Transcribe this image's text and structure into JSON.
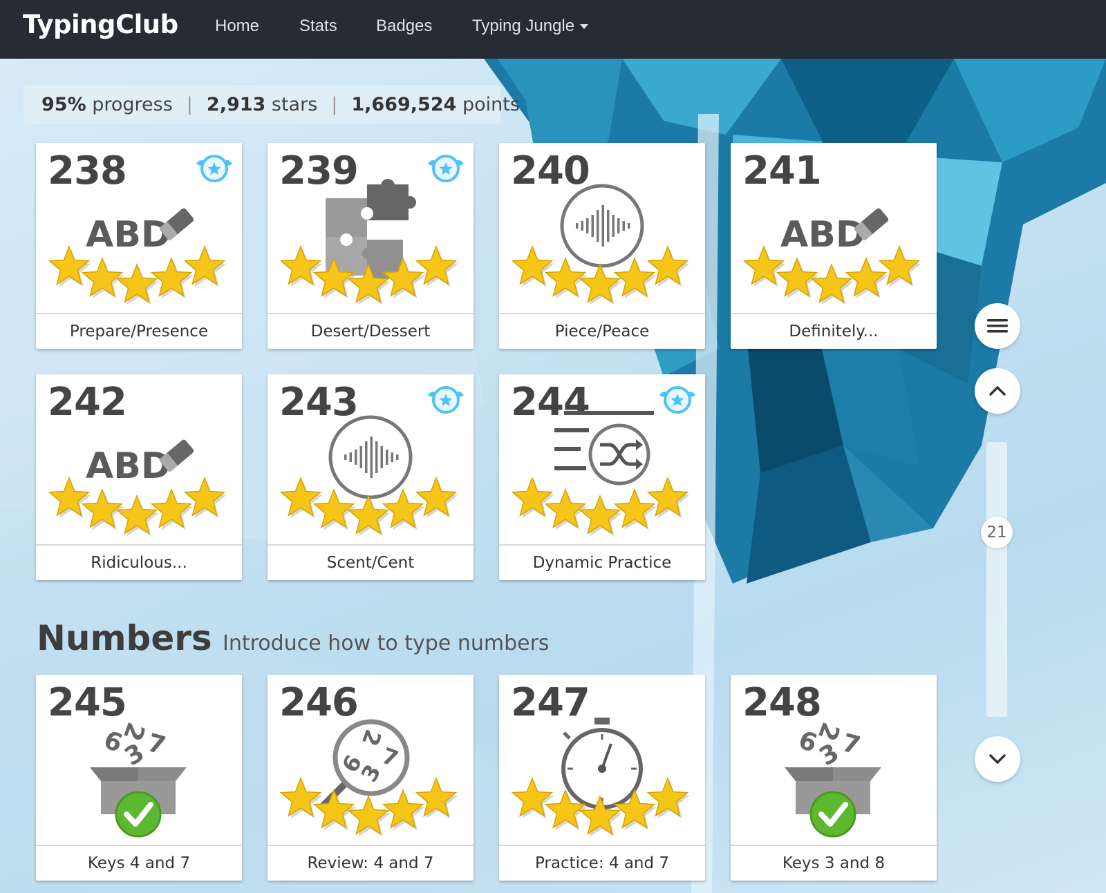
{
  "app": {
    "brand": "TypingClub"
  },
  "nav": {
    "home": "Home",
    "stats": "Stats",
    "badges": "Badges",
    "course": "Typing Jungle"
  },
  "stats": {
    "progress_value": "95%",
    "progress_label": "progress",
    "stars_value": "2,913",
    "stars_label": "stars",
    "points_value": "1,669,524",
    "points_label": "points"
  },
  "lessons": [
    {
      "number": "238",
      "title": "Prepare/Presence",
      "icon": "eraser-abc-icon",
      "stars": 5,
      "badge": true
    },
    {
      "number": "239",
      "title": "Desert/Dessert",
      "icon": "puzzle-icon",
      "stars": 5,
      "badge": true
    },
    {
      "number": "240",
      "title": "Piece/Peace",
      "icon": "sound-wave-icon",
      "stars": 5,
      "badge": false
    },
    {
      "number": "241",
      "title": "Definitely...",
      "icon": "eraser-abc-icon",
      "stars": 5,
      "badge": false
    },
    {
      "number": "242",
      "title": "Ridiculous...",
      "icon": "eraser-abc-icon",
      "stars": 5,
      "badge": false
    },
    {
      "number": "243",
      "title": "Scent/Cent",
      "icon": "sound-wave-icon",
      "stars": 5,
      "badge": true
    },
    {
      "number": "244",
      "title": "Dynamic Practice",
      "icon": "shuffle-list-icon",
      "stars": 5,
      "badge": true
    },
    {
      "number": "245",
      "title": "Keys 4 and 7",
      "icon": "number-box-check-icon",
      "stars": 0,
      "badge": false
    },
    {
      "number": "246",
      "title": "Review: 4 and 7",
      "icon": "magnifier-numbers-icon",
      "stars": 5,
      "badge": false
    },
    {
      "number": "247",
      "title": "Practice: 4 and 7",
      "icon": "stopwatch-icon",
      "stars": 5,
      "badge": false
    },
    {
      "number": "248",
      "title": "Keys 3 and 8",
      "icon": "number-box-check-icon",
      "stars": 0,
      "badge": false
    }
  ],
  "section": {
    "title": "Numbers",
    "subtitle": "Introduce how to type numbers"
  },
  "icon_text": {
    "abc": "ABD",
    "digits": [
      "6",
      "2",
      "3",
      "7"
    ]
  },
  "scroll": {
    "page_indicator": "21"
  },
  "controls": {
    "menu_icon": "hamburger-menu-icon",
    "up_icon": "chevron-up-icon",
    "down_icon": "chevron-down-icon"
  },
  "colors": {
    "topbar": "#262c35",
    "star": "#f5c518",
    "badge": "#4ec3f0",
    "check": "#5cb82e",
    "icon_gray": "#777777",
    "ice_dark": "#0e5f85",
    "ice_light": "#3aa8cf"
  }
}
